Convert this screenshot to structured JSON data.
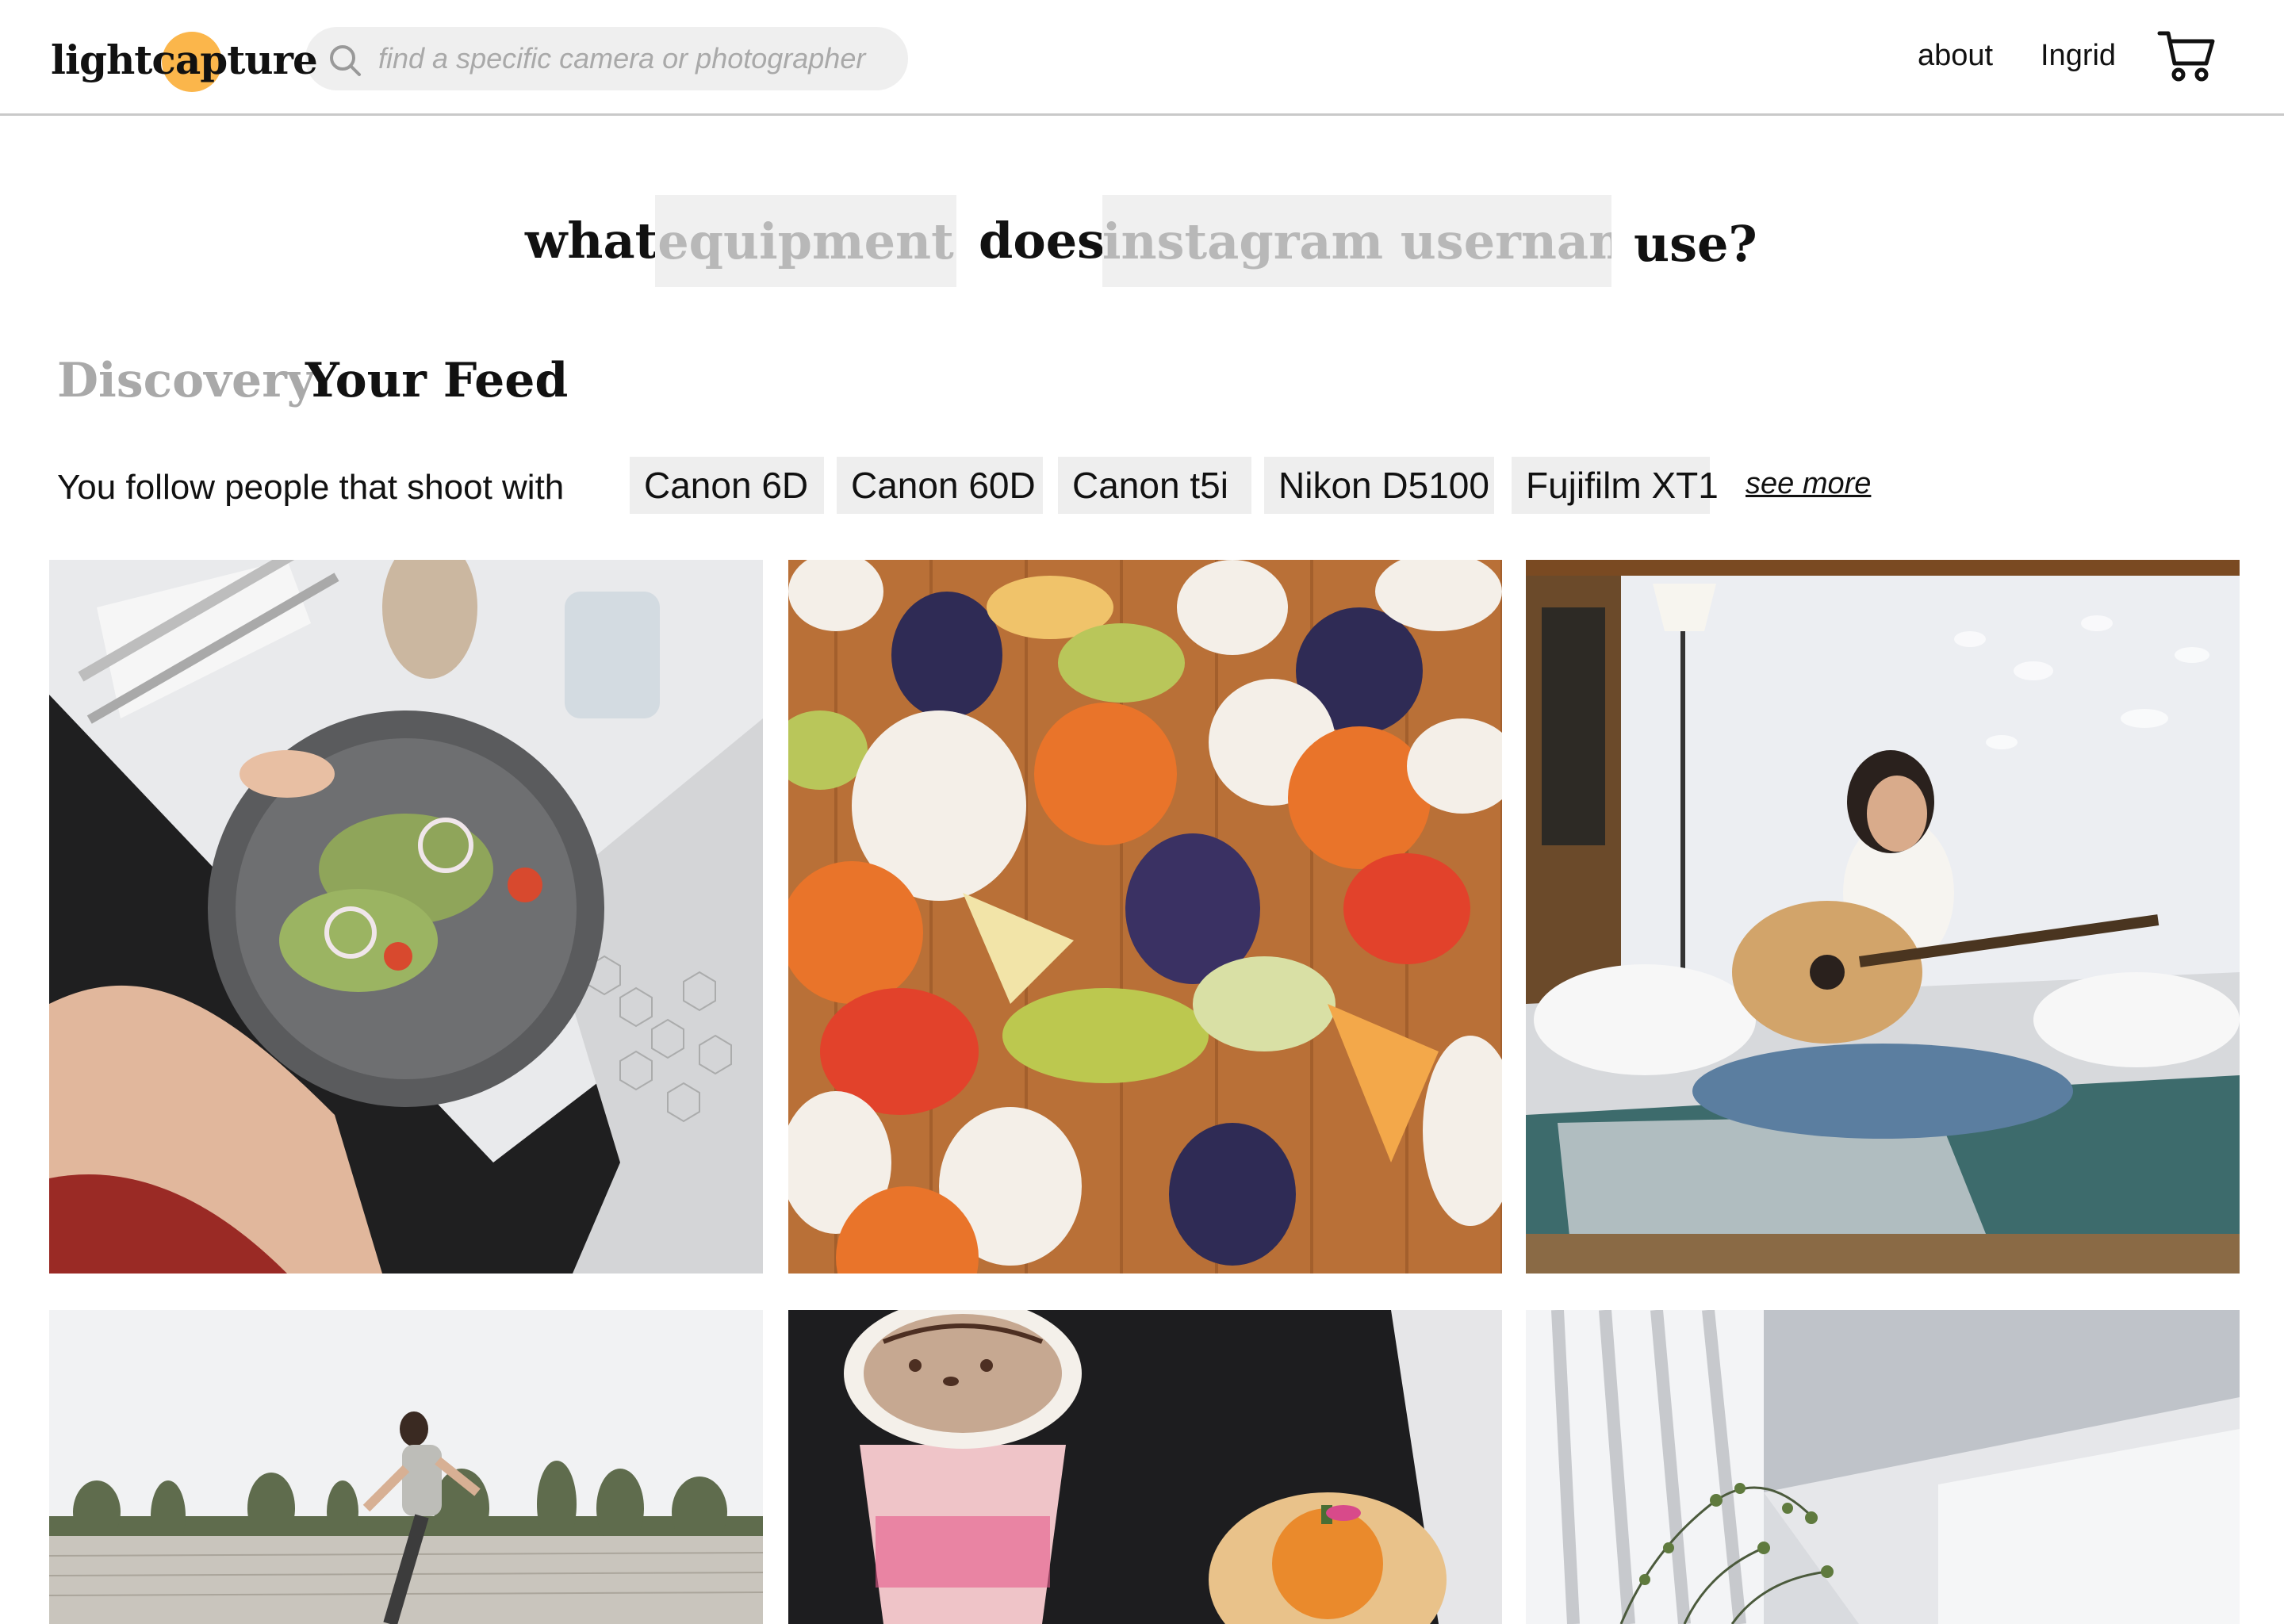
{
  "header": {
    "logo": "lightcapture",
    "search_placeholder": "find a specific camera or photographer",
    "nav_about": "about",
    "nav_user": "Ingrid"
  },
  "query": {
    "word_what": "what",
    "equipment_placeholder": "equipment",
    "word_does": "does",
    "username_placeholder": "instagram username",
    "word_use": "use?"
  },
  "tabs": [
    {
      "label": "Discovery",
      "active": false
    },
    {
      "label": "Your Feed",
      "active": true
    }
  ],
  "follow": {
    "label": "You follow people that shoot with",
    "cameras": [
      "Canon 6D",
      "Canon 60D",
      "Canon t5i",
      "Nikon D5100",
      "Fujifilm XT1"
    ],
    "see_more": "see more"
  },
  "colors": {
    "accent": "#fbb64b",
    "chip_bg": "#eeeeee",
    "muted_text": "#a9a9a9"
  },
  "photos": [
    {
      "subject": "avocado toast plate on white table"
    },
    {
      "subject": "halloween iced cookies"
    },
    {
      "subject": "woman playing acoustic guitar on bed"
    },
    {
      "subject": "woman running in stadium"
    },
    {
      "subject": "hello kitty coffee and pumpkin tart"
    },
    {
      "subject": "white building with plant"
    }
  ]
}
